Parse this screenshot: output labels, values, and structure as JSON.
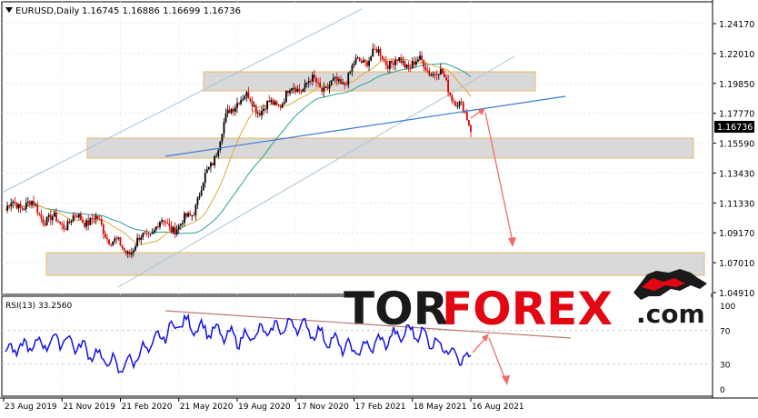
{
  "window": {
    "symbol": "EURUSD,Daily",
    "ohlc": "1.16745 1.16886 1.16699 1.16736",
    "dropdown_icon": "triangle-down-icon"
  },
  "indicator": {
    "label": "RSI(13) 33.2560"
  },
  "watermark": {
    "text_dark": "TOR",
    "text_red": "FOREX",
    "text_suffix": ".com",
    "logo_icon": "bull-bear-icon"
  },
  "colors": {
    "up_candle": "#000000",
    "down_candle": "#d40000",
    "ma_fast": "#e0a93e",
    "ma_slow": "#2aa198",
    "trendline": "#3a7bd5",
    "channel": "#a9c4d6",
    "rsi_line": "#1414e6",
    "rsi_trend": "#b97a74",
    "arrow": "#f06b6b",
    "zone_fill": "#d9d9d9",
    "zone_border": "#e8b86a",
    "brand_red": "#e30613",
    "brand_dark": "#1a1a1a"
  },
  "chart_data": [
    {
      "type": "line",
      "description": "EURUSD daily candlestick chart",
      "series": [
        {
          "name": "EURUSD",
          "x": [
            "23 Aug 2019",
            "21 Nov 2019",
            "21 Feb 2020",
            "21 May 2020",
            "19 Aug 2020",
            "17 Nov 2020",
            "17 Feb 2021",
            "18 May 2021",
            "16 Aug 2021"
          ],
          "y": [
            1.108,
            1.105,
            1.085,
            1.095,
            1.185,
            1.19,
            1.21,
            1.22,
            1.174
          ]
        }
      ],
      "price_axis": [
        "1.24170",
        "1.22010",
        "1.19850",
        "1.17770",
        "1.15590",
        "1.13430",
        "1.11330",
        "1.09170",
        "1.07010",
        "1.04910"
      ],
      "current_price": "1.16736",
      "time_axis": [
        "23 Aug 2019",
        "21 Nov 2019",
        "21 Feb 2020",
        "21 May 2020",
        "19 Aug 2020",
        "17 Nov 2020",
        "17 Feb 2021",
        "18 May 2021",
        "16 Aug 2021"
      ],
      "ylim": [
        1.0491,
        1.2417
      ]
    },
    {
      "type": "line",
      "description": "RSI(13) oscillator",
      "series": [
        {
          "name": "RSI(13)",
          "x": [
            "23 Aug 2019",
            "21 Nov 2019",
            "21 Feb 2020",
            "21 May 2020",
            "19 Aug 2020",
            "17 Nov 2020",
            "17 Feb 2021",
            "18 May 2021",
            "16 Aug 2021"
          ],
          "y": [
            45,
            60,
            25,
            80,
            60,
            78,
            45,
            70,
            33.256
          ]
        }
      ],
      "levels": [
        "100",
        "70",
        "30",
        "0"
      ],
      "ylim": [
        0,
        100
      ]
    }
  ]
}
